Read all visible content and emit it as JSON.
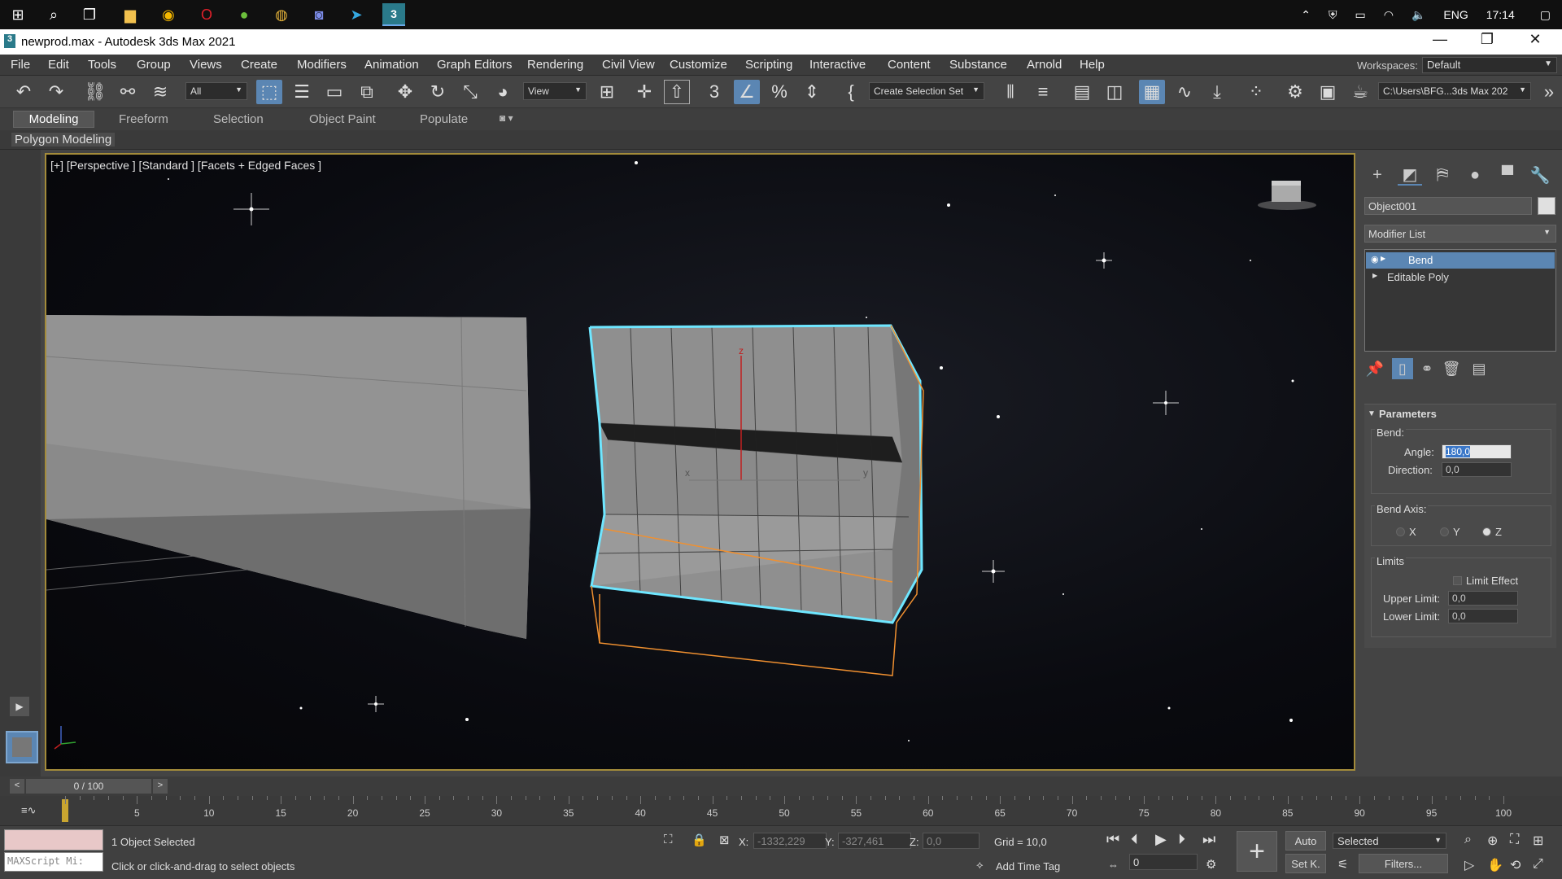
{
  "taskbar": {
    "icons": [
      "windows-start-icon",
      "search-icon",
      "task-view-icon",
      "file-explorer-icon",
      "app-a-icon",
      "opera-icon",
      "utorrent-icon",
      "chrome-icon",
      "discord-icon",
      "telegram-icon",
      "3dsmax-icon"
    ],
    "lang": "ENG",
    "time": "17:14"
  },
  "window": {
    "title": "newprod.max - Autodesk 3ds Max 2021"
  },
  "menu": {
    "items": [
      "File",
      "Edit",
      "Tools",
      "Group",
      "Views",
      "Create",
      "Modifiers",
      "Animation",
      "Graph Editors",
      "Rendering",
      "Civil View",
      "Customize",
      "Scripting",
      "Interactive",
      "Content",
      "Substance",
      "Arnold",
      "Help"
    ],
    "workspaces_label": "Workspaces:",
    "workspace_value": "Default"
  },
  "toolbar": {
    "filter": "All",
    "ref_coord": "View",
    "selection_set": "Create Selection Set",
    "project_path": "C:\\Users\\BFG...3ds Max 202"
  },
  "ribbon": {
    "tabs": [
      "Modeling",
      "Freeform",
      "Selection",
      "Object Paint",
      "Populate"
    ],
    "sub_label": "Polygon Modeling"
  },
  "viewport": {
    "label": "[+] [Perspective ] [Standard ] [Facets + Edged Faces ]",
    "gizmo_z": "z",
    "gizmo_x": "x",
    "gizmo_y": "y"
  },
  "command_panel": {
    "object_name": "Object001",
    "modifier_list": "Modifier List",
    "stack": [
      "Bend",
      "Editable Poly"
    ],
    "parameters": {
      "title": "Parameters",
      "bend_label": "Bend:",
      "angle_label": "Angle:",
      "angle_value": "180,0",
      "direction_label": "Direction:",
      "direction_value": "0,0",
      "bend_axis_label": "Bend Axis:",
      "axis_x": "X",
      "axis_y": "Y",
      "axis_z": "Z",
      "limits_label": "Limits",
      "limit_effect": "Limit Effect",
      "upper_label": "Upper Limit:",
      "upper_value": "0,0",
      "lower_label": "Lower Limit:",
      "lower_value": "0,0"
    }
  },
  "timeline": {
    "frame": "0 / 100",
    "ticks": [
      "5",
      "10",
      "15",
      "20",
      "25",
      "30",
      "35",
      "40",
      "45",
      "50",
      "55",
      "60",
      "65",
      "70",
      "75",
      "80",
      "85",
      "90",
      "95",
      "100"
    ]
  },
  "status": {
    "maxscript": "MAXScript Mi:",
    "selected": "1 Object Selected",
    "prompt": "Click or click-and-drag to select objects",
    "x_label": "X:",
    "x_value": "-1332,229",
    "y_label": "Y:",
    "y_value": "-327,461",
    "z_label": "Z:",
    "z_value": "0,0",
    "grid": "Grid = 10,0",
    "add_time_tag": "Add Time Tag",
    "frame_field": "0",
    "auto": "Auto",
    "set_key": "Set K.",
    "key_mode": "Selected",
    "filters": "Filters..."
  }
}
